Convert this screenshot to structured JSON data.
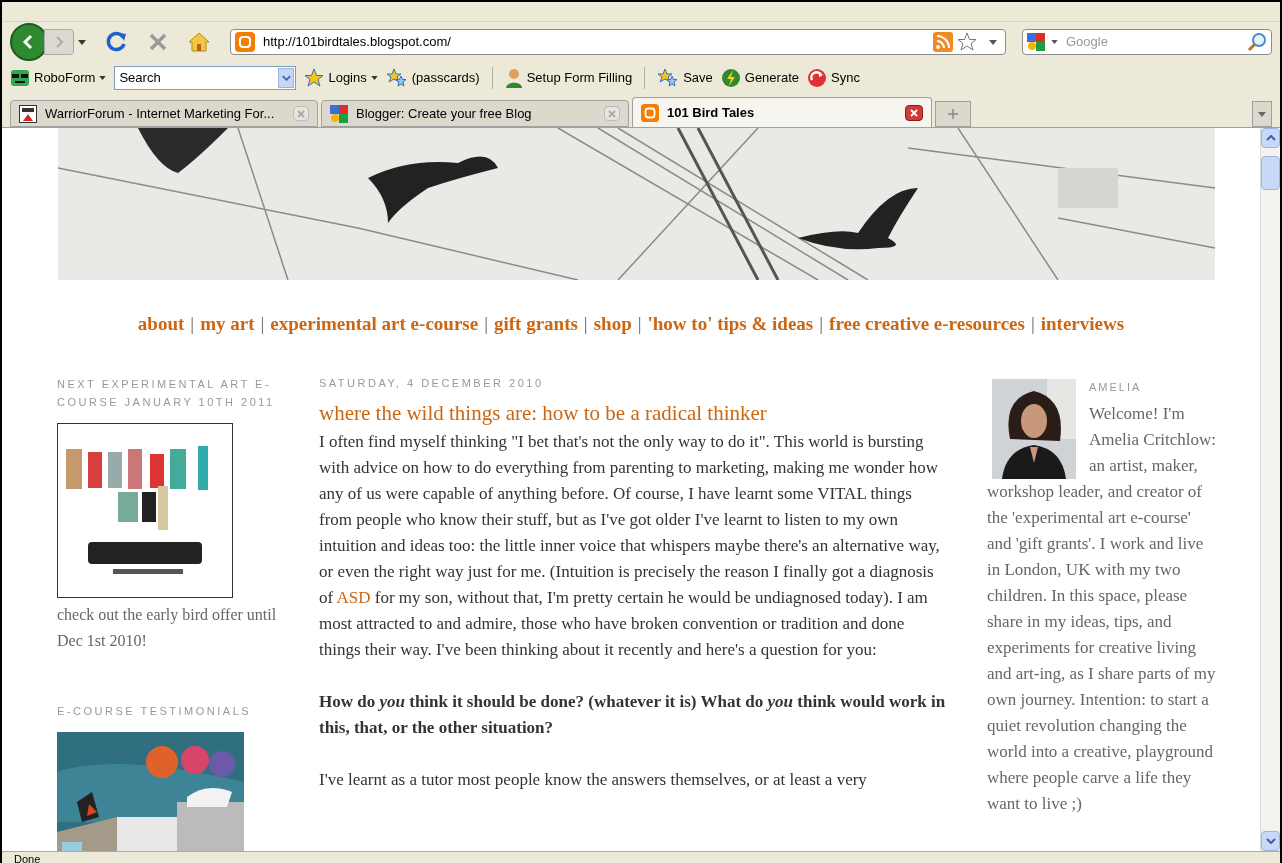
{
  "browser": {
    "address": "http://101birdtales.blogspot.com/",
    "search_placeholder": "Google"
  },
  "toolbar": [
    {
      "kind": "dropdown",
      "label": "RoboForm",
      "separator_before": false
    },
    {
      "kind": "search",
      "placeholder": "Search",
      "separator_before": false
    },
    {
      "kind": "dropdown",
      "label": "Logins",
      "separator_before": false
    },
    {
      "kind": "button",
      "label": "(passcards)",
      "separator_before": false
    },
    {
      "kind": "button",
      "label": "Setup Form Filling",
      "separator_before": true
    },
    {
      "kind": "button",
      "label": "Save",
      "separator_before": true
    },
    {
      "kind": "button",
      "label": "Generate",
      "separator_before": false
    },
    {
      "kind": "button",
      "label": "Sync",
      "separator_before": false
    }
  ],
  "tabs": [
    {
      "title": "WarriorForum - Internet Marketing For...",
      "selected": false
    },
    {
      "title": "Blogger: Create your free Blog",
      "selected": false
    },
    {
      "title": "101 Bird Tales",
      "selected": true
    }
  ],
  "nav_separator": "|",
  "nav": [
    "about",
    "my art",
    "experimental art e-course",
    "gift grants",
    "shop",
    "'how to' tips & ideas",
    "free creative e-resources",
    "interviews"
  ],
  "left_sidebar": [
    {
      "heading": "NEXT EXPERIMENTAL ART E-COURSE JANUARY 10TH 2011",
      "caption": "check out the early bird offer until Dec 1st 2010!"
    },
    {
      "heading": "E-COURSE TESTIMONIALS"
    }
  ],
  "post": {
    "date": "SATURDAY, 4 DECEMBER 2010",
    "title": "where the wild things are: how to be a radical thinker",
    "paragraphs": [
      {
        "kind": "text",
        "before": "I often find myself thinking \"I bet that's not the only way to do it\". This world is bursting with advice on how to do everything from parenting to marketing, making me wonder how any of us were capable of anything before. Of course, I have learnt some VITAL things from people who know their stuff, but as I've got older I've learnt to listen to my own intuition and ideas too: the little inner voice that whispers maybe there's an alternative way, or even the right way just for me. (Intuition is precisely the reason I finally got a diagnosis of",
        "link": "ASD",
        "after": "for my son, without that, I'm pretty certain he would be undiagnosed today). I am most attracted to and admire, those who have broken convention or tradition and done things their way. I've been thinking about it recently and here's a question for you:"
      },
      {
        "kind": "question",
        "text": "How do *you* think it should be done? (whatever it is) What do *you* think would work in this, that, or the other situation?"
      },
      {
        "kind": "text",
        "before": "I've learnt as a tutor most people know the answers themselves, or at least a very"
      }
    ]
  },
  "profile": {
    "name": "AMELIA",
    "bio_intro": "Welcome! I'm Amelia Critchlow: an artist, maker,",
    "bio": "workshop leader, and creator of the 'experimental art e-course' and 'gift grants'. I work and live in London, UK with my two children. In this space, please share in my ideas, tips, and experiments for creative living and art-ing, as I share parts of my own journey. Intention: to start a quiet revolution changing the world into a creative, playground where people carve a life they want to live ;)"
  },
  "status_bar": "Done"
}
